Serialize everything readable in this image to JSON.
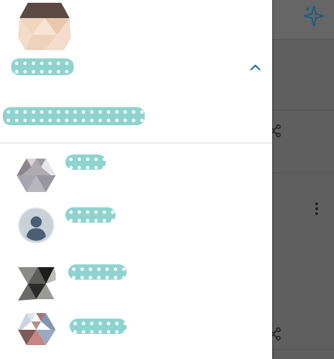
{
  "drawer": {
    "account": {
      "name": "",
      "email": "",
      "toggle_icon": "chevron-up-icon",
      "avatar_icon": "geometric-avatar-icon"
    },
    "other_accounts": [
      {
        "name": "",
        "avatar_icon": "geometric-avatar-icon"
      },
      {
        "name": "",
        "avatar_icon": "default-person-avatar-icon"
      },
      {
        "name": "",
        "avatar_icon": "geometric-avatar-icon"
      },
      {
        "name": "",
        "avatar_icon": "geometric-avatar-icon"
      }
    ]
  },
  "background": {
    "icons": [
      "sparkle-icon",
      "share-icon",
      "more-vert-icon",
      "share-icon"
    ]
  },
  "colors": {
    "accent": "#1a73a8",
    "scrim": "#5f5f5f",
    "drawer_bg": "#ffffff"
  }
}
